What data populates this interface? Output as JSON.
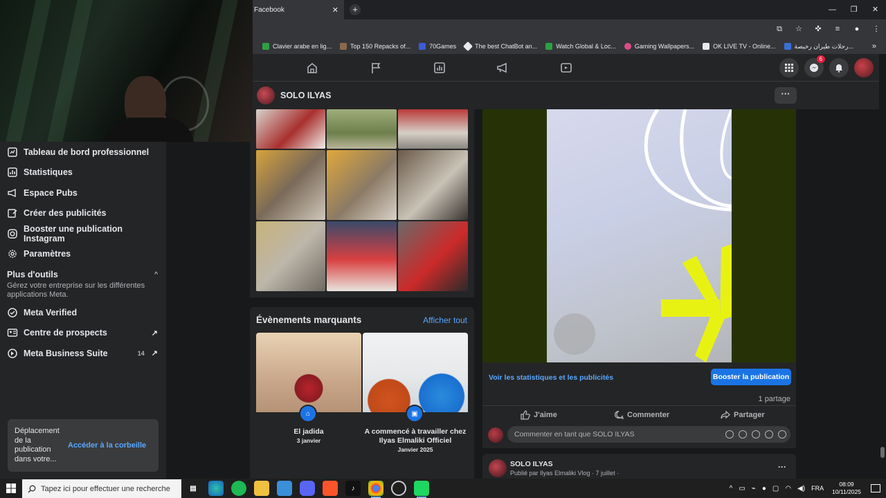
{
  "browser": {
    "tab_title": "Facebook",
    "tab_close": "✕",
    "new_tab": "+",
    "window_controls": [
      "—",
      "❐",
      "✕"
    ],
    "bookmarks": [
      {
        "label": "Clavier arabe en lig...",
        "color": "#2ea043"
      },
      {
        "label": "Top 150 Repacks of...",
        "color": "#8a6a4a"
      },
      {
        "label": "70Games",
        "color": "#3c5bd6"
      },
      {
        "label": "The best ChatBot an...",
        "color": "#e8eaed"
      },
      {
        "label": "Watch Global & Loc...",
        "color": "#2ea043"
      },
      {
        "label": "Gaming Wallpapers...",
        "color": "#d94d86"
      },
      {
        "label": "OK LIVE TV - Online...",
        "color": "#e8eaed"
      },
      {
        "label": "رحلات طيران رخيصة...",
        "color": "#3a6fd8"
      }
    ],
    "bookmarks_more": "»"
  },
  "sidebar": {
    "items": [
      {
        "label": "Tableau de bord professionnel",
        "icon": "dashboard-icon"
      },
      {
        "label": "Statistiques",
        "icon": "statistics-icon"
      },
      {
        "label": "Espace Pubs",
        "icon": "megaphone-icon"
      },
      {
        "label": "Créer des publicités",
        "icon": "edit-icon"
      },
      {
        "label": "Booster une publication Instagram",
        "icon": "instagram-icon"
      },
      {
        "label": "Paramètres",
        "icon": "gear-icon"
      }
    ],
    "more_tools": {
      "heading": "Plus d'outils",
      "description": "Gérez votre entreprise sur les différentes applications Meta.",
      "chevron": "^"
    },
    "tools": [
      {
        "label": "Meta Verified",
        "icon": "verified-icon",
        "arrow": ""
      },
      {
        "label": "Centre de prospects",
        "icon": "leads-icon",
        "arrow": "↗"
      },
      {
        "label": "Meta Business Suite",
        "icon": "business-suite-icon",
        "count": "14",
        "arrow": "↗"
      }
    ],
    "toast": {
      "text": "Déplacement de la publication dans votre...",
      "action": "Accéder à la corbeille"
    }
  },
  "profile": {
    "name": "SOLO ILYAS",
    "more": "···"
  },
  "fb_nav": {
    "notification_count": "6"
  },
  "events": {
    "title": "Évènements marquants",
    "see_all": "Afficher tout",
    "items": [
      {
        "name": "El jadida",
        "date": "3 janvier"
      },
      {
        "name": "A commencé à travailler chez Ilyas Elmaliki Officiel",
        "date": "Janvier 2025"
      }
    ]
  },
  "post": {
    "stats_link": "Voir les statistiques et les publicités",
    "boost_button": "Booster la publication",
    "shares": "1 partage",
    "actions": {
      "like": "J'aime",
      "comment": "Commenter",
      "share": "Partager"
    },
    "comment_placeholder": "Commenter en tant que SOLO ILYAS"
  },
  "next_post": {
    "author": "SOLO ILYAS",
    "subtitle": "Publié par Ilyas Elmaliki Vlog · 7 juillet ·",
    "more": "···"
  },
  "taskbar": {
    "search_placeholder": "Tapez ici pour effectuer une recherche",
    "language": "FRA",
    "time": "08:09",
    "date": "10/11/2025"
  }
}
